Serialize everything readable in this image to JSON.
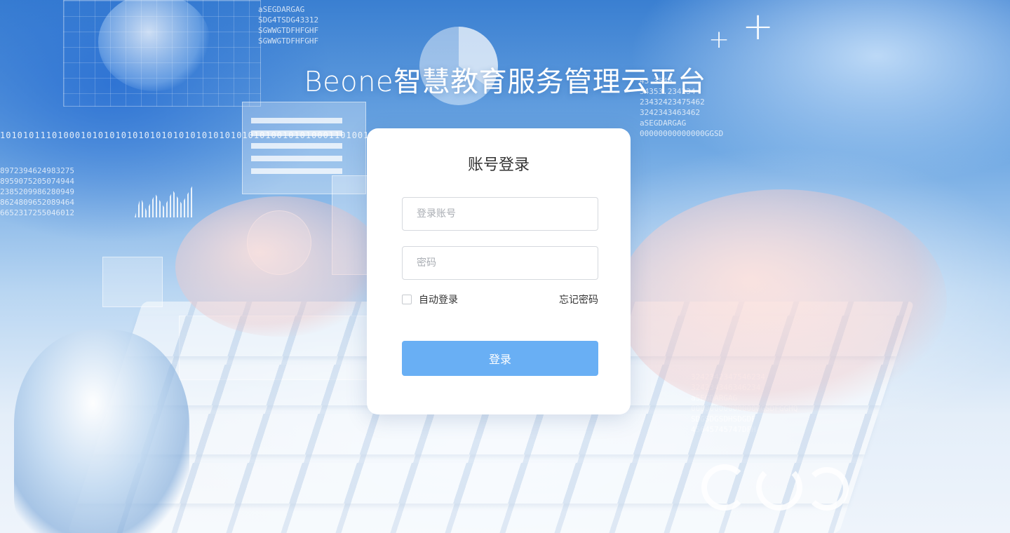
{
  "page": {
    "title": "Beone智慧教育服务管理云平台"
  },
  "login": {
    "heading": "账号登录",
    "account_placeholder": "登录账号",
    "account_value": "",
    "password_placeholder": "密码",
    "password_value": "",
    "remember_label": "自动登录",
    "remember_checked": false,
    "forgot_label": "忘记密码",
    "submit_label": "登录"
  },
  "colors": {
    "primary_button": "#69aff4",
    "card_background": "#ffffff",
    "title_text": "#ffffff"
  }
}
